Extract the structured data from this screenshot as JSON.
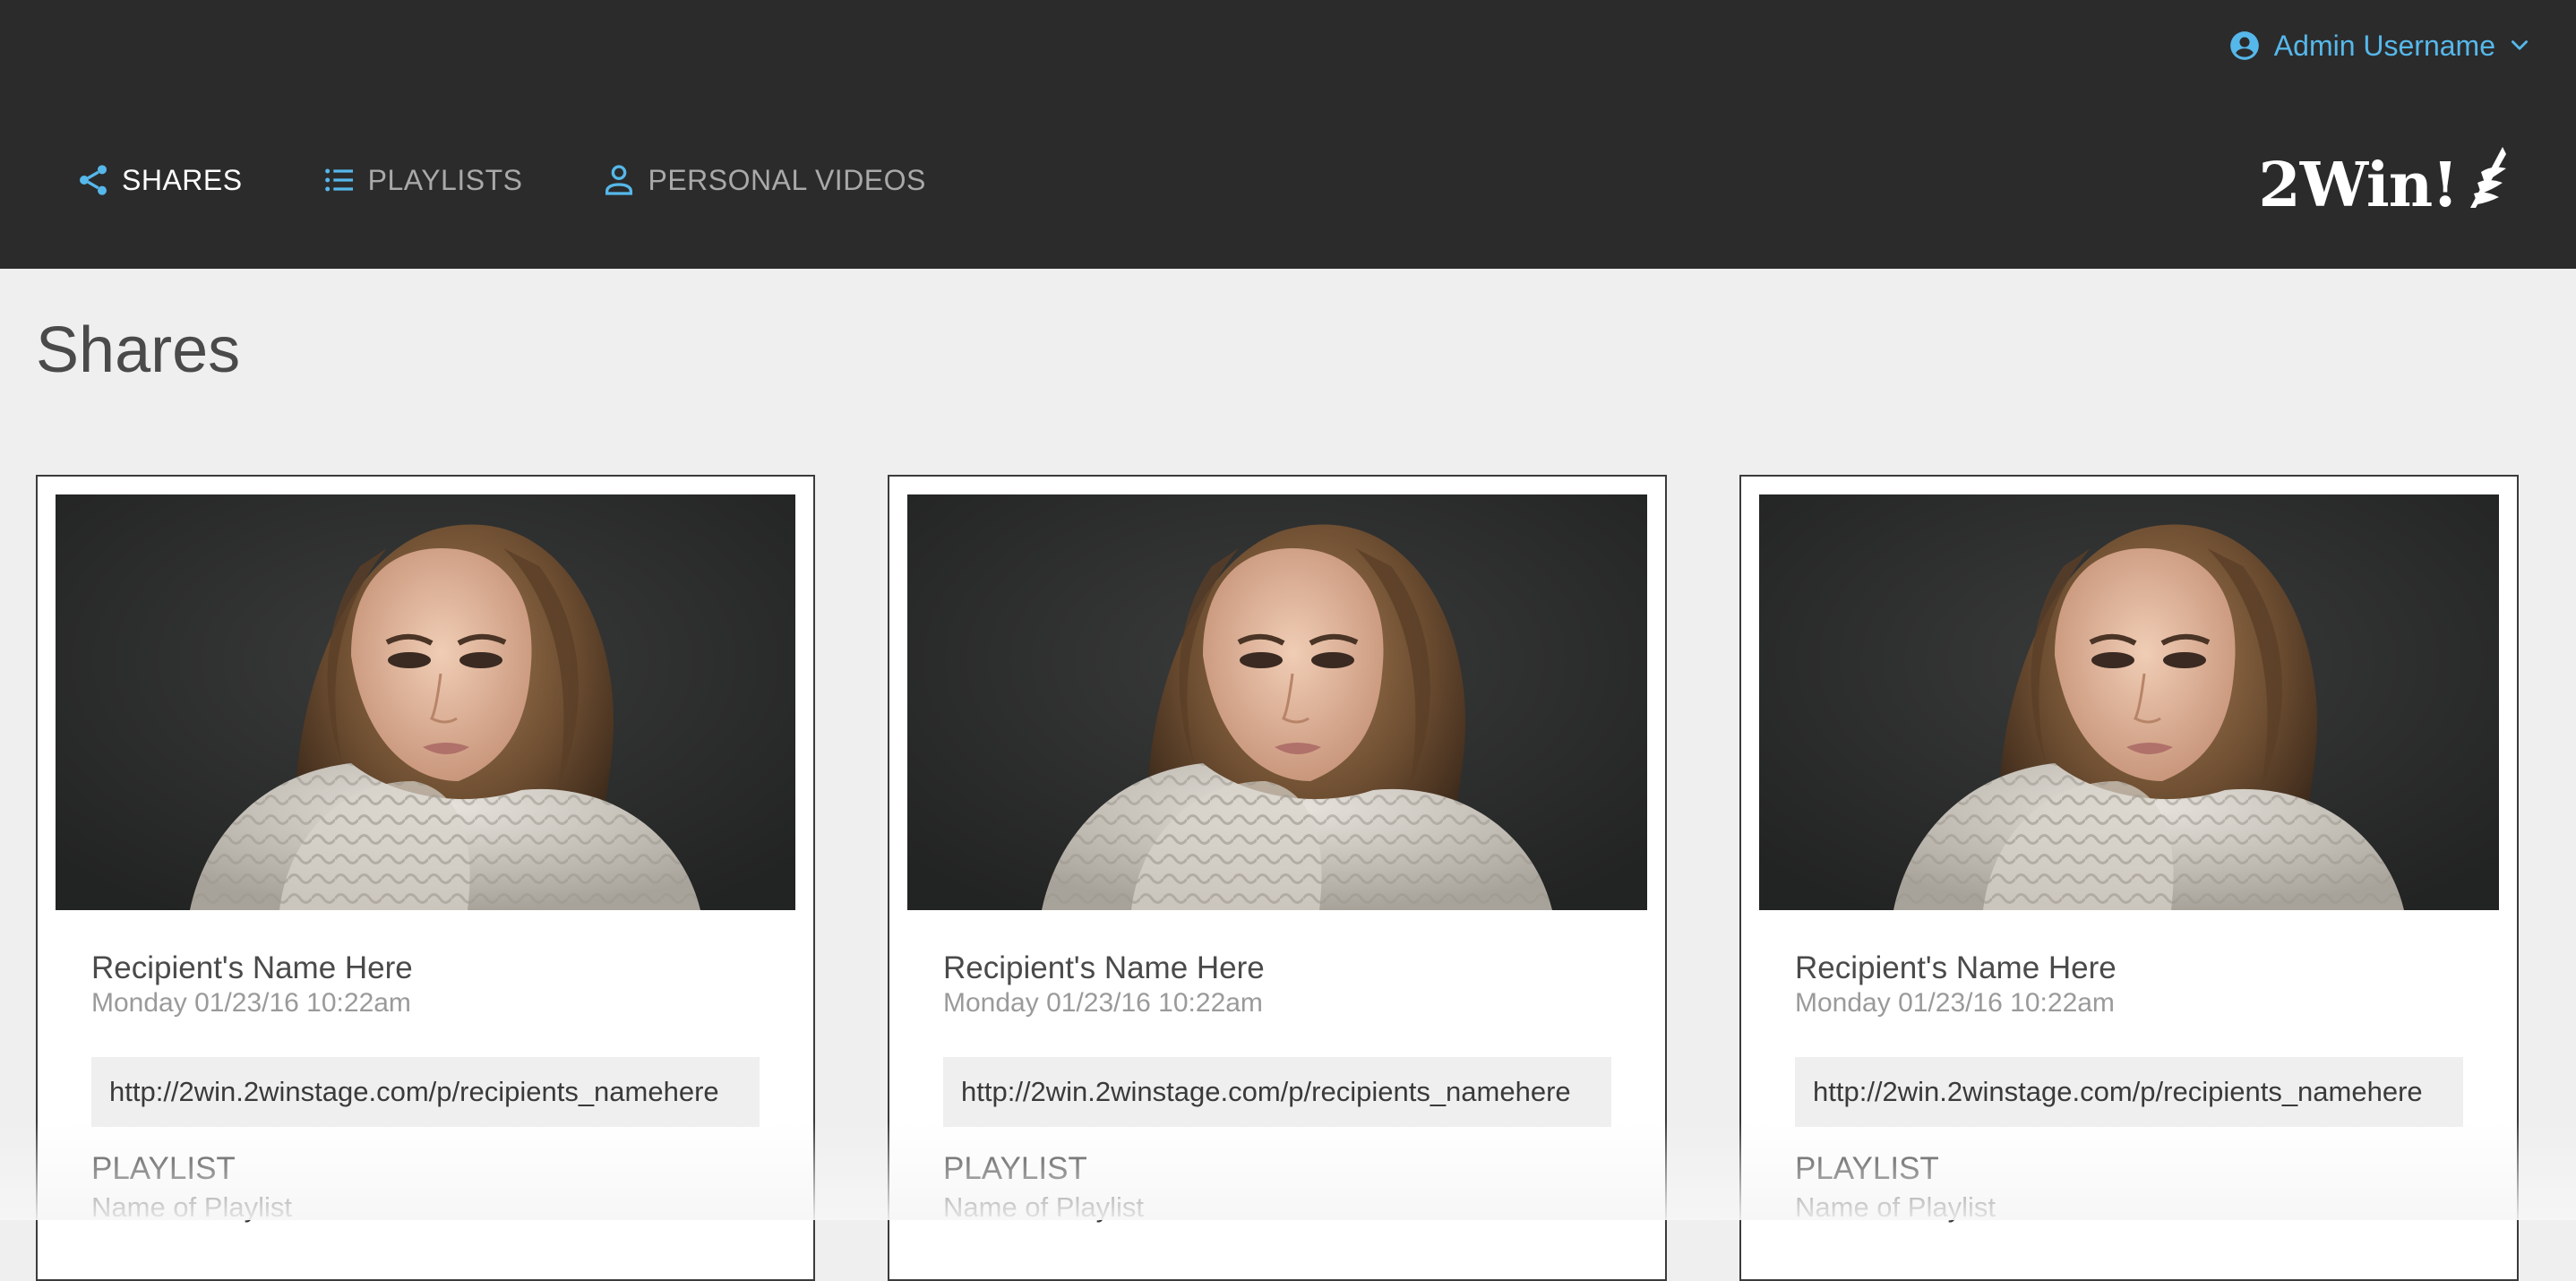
{
  "header": {
    "user_name": "Admin Username",
    "user_icon": "account-circle-icon",
    "menu_icon": "chevron-down-icon",
    "accent_color": "#56b8ea",
    "background_color": "#2b2b2c"
  },
  "nav": {
    "items": [
      {
        "label": "SHARES",
        "icon": "share-icon",
        "active": true
      },
      {
        "label": "PLAYLISTS",
        "icon": "list-icon",
        "active": false
      },
      {
        "label": "PERSONAL VIDEOS",
        "icon": "person-icon",
        "active": false
      }
    ]
  },
  "brand": {
    "logo_text": "2Win!"
  },
  "page": {
    "title": "Shares"
  },
  "cards": [
    {
      "recipient": "Recipient's Name Here",
      "date": "Monday 01/23/16 10:22am",
      "link": "http://2win.2winstage.com/p/recipients_namehere",
      "playlist_heading": "PLAYLIST",
      "playlist_name": "Name of Playlist"
    },
    {
      "recipient": "Recipient's Name Here",
      "date": "Monday 01/23/16 10:22am",
      "link": "http://2win.2winstage.com/p/recipients_namehere",
      "playlist_heading": "PLAYLIST",
      "playlist_name": "Name of Playlist"
    },
    {
      "recipient": "Recipient's Name Here",
      "date": "Monday 01/23/16 10:22am",
      "link": "http://2win.2winstage.com/p/recipients_namehere",
      "playlist_heading": "PLAYLIST",
      "playlist_name": "Name of Playlist"
    }
  ]
}
